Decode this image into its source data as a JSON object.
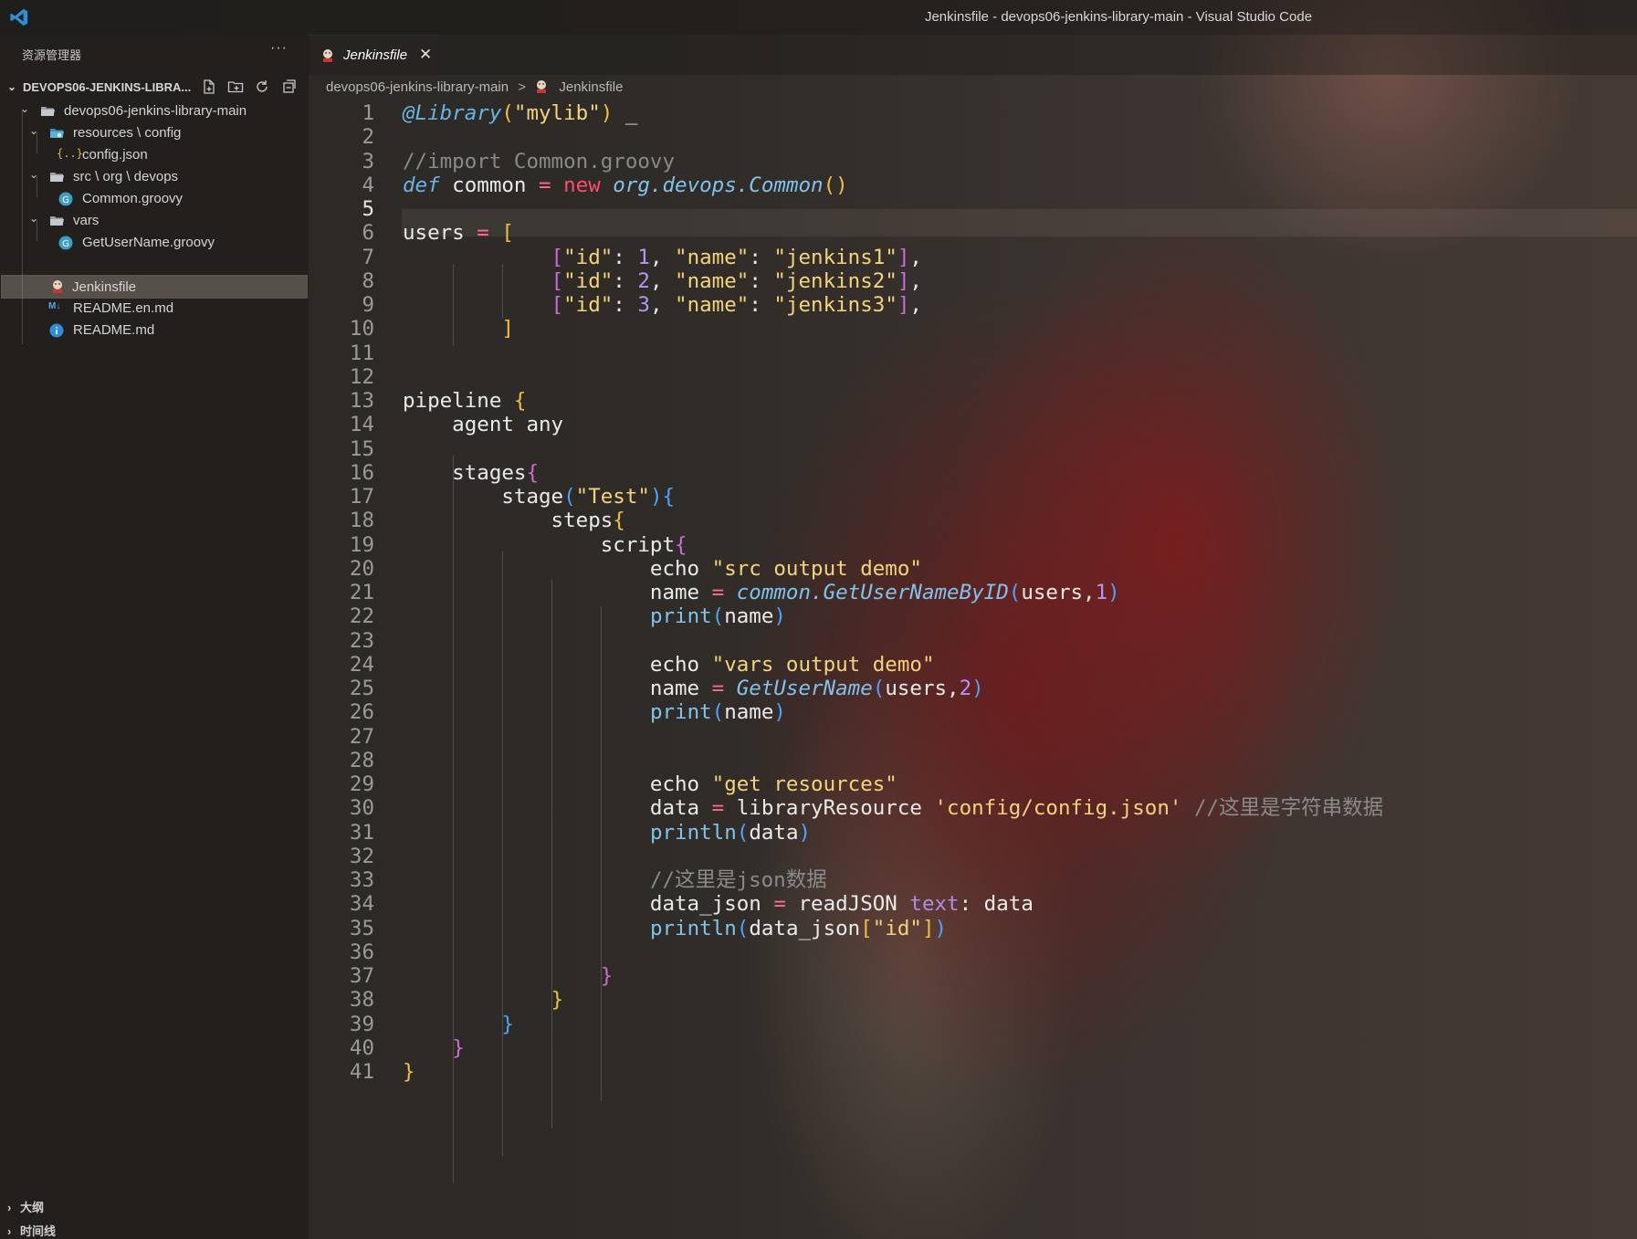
{
  "window": {
    "title": "Jenkinsfile - devops06-jenkins-library-main - Visual Studio Code"
  },
  "sidebar": {
    "header": "资源管理器",
    "more": "···",
    "root_folder": "DEVOPS06-JENKINS-LIBRA...",
    "tree": [
      {
        "label": "devops06-jenkins-library-main",
        "kind": "folder-open"
      },
      {
        "label": "resources \\ config",
        "kind": "folder-open"
      },
      {
        "label": "config.json",
        "kind": "json-file"
      },
      {
        "label": "src \\ org \\ devops",
        "kind": "folder-open"
      },
      {
        "label": "Common.groovy",
        "kind": "groovy-file"
      },
      {
        "label": "vars",
        "kind": "folder-open"
      },
      {
        "label": "GetUserName.groovy",
        "kind": "groovy-file"
      },
      {
        "label": "Jenkinsfile",
        "kind": "jenkins-file",
        "selected": true
      },
      {
        "label": "README.en.md",
        "kind": "markdown-file"
      },
      {
        "label": "README.md",
        "kind": "info-file"
      }
    ],
    "outline_label": "大纲",
    "timeline_label": "时间线"
  },
  "tabs": [
    {
      "label": "Jenkinsfile",
      "close": "✕",
      "active": true
    }
  ],
  "breadcrumb": {
    "folder": "devops06-jenkins-library-main",
    "separator": ">",
    "file": "Jenkinsfile"
  },
  "editor": {
    "active_line": 5,
    "line_numbers": [
      "1",
      "2",
      "3",
      "4",
      "5",
      "6",
      "7",
      "8",
      "9",
      "10",
      "11",
      "12",
      "13",
      "14",
      "15",
      "16",
      "17",
      "18",
      "19",
      "20",
      "21",
      "22",
      "23",
      "24",
      "25",
      "26",
      "27",
      "28",
      "29",
      "30",
      "31",
      "32",
      "33",
      "34",
      "35",
      "36",
      "37",
      "38",
      "39",
      "40",
      "41"
    ],
    "lines": [
      [
        [
          "c-deco",
          "@Library"
        ],
        [
          "c-p1",
          "("
        ],
        [
          "c-str",
          "\"mylib\""
        ],
        [
          "c-p1",
          ")"
        ],
        [
          "c-var",
          " _"
        ]
      ],
      [],
      [
        [
          "c-cm",
          "//import Common.groovy"
        ]
      ],
      [
        [
          "c-kw",
          "def"
        ],
        [
          "c-var",
          " common "
        ],
        [
          "c-op",
          "="
        ],
        [
          "c-new",
          " new"
        ],
        [
          "c-cls",
          " org.devops.Common"
        ],
        [
          "c-p1",
          "()"
        ]
      ],
      [],
      [
        [
          "c-var",
          "users "
        ],
        [
          "c-op",
          "="
        ],
        [
          "c-p1",
          " ["
        ]
      ],
      [
        [
          "c-var",
          "            "
        ],
        [
          "c-p2",
          "["
        ],
        [
          "c-str",
          "\"id\""
        ],
        [
          "c-var",
          ": "
        ],
        [
          "c-num",
          "1"
        ],
        [
          "c-var",
          ", "
        ],
        [
          "c-str",
          "\"name\""
        ],
        [
          "c-var",
          ": "
        ],
        [
          "c-str",
          "\"jenkins1\""
        ],
        [
          "c-p2",
          "]"
        ],
        [
          "c-var",
          ","
        ]
      ],
      [
        [
          "c-var",
          "            "
        ],
        [
          "c-p2",
          "["
        ],
        [
          "c-str",
          "\"id\""
        ],
        [
          "c-var",
          ": "
        ],
        [
          "c-num",
          "2"
        ],
        [
          "c-var",
          ", "
        ],
        [
          "c-str",
          "\"name\""
        ],
        [
          "c-var",
          ": "
        ],
        [
          "c-str",
          "\"jenkins2\""
        ],
        [
          "c-p2",
          "]"
        ],
        [
          "c-var",
          ","
        ]
      ],
      [
        [
          "c-var",
          "            "
        ],
        [
          "c-p2",
          "["
        ],
        [
          "c-str",
          "\"id\""
        ],
        [
          "c-var",
          ": "
        ],
        [
          "c-num",
          "3"
        ],
        [
          "c-var",
          ", "
        ],
        [
          "c-str",
          "\"name\""
        ],
        [
          "c-var",
          ": "
        ],
        [
          "c-str",
          "\"jenkins3\""
        ],
        [
          "c-p2",
          "]"
        ],
        [
          "c-var",
          ","
        ]
      ],
      [
        [
          "c-var",
          "        "
        ],
        [
          "c-p1",
          "]"
        ]
      ],
      [],
      [],
      [
        [
          "c-var",
          "pipeline "
        ],
        [
          "c-p1",
          "{"
        ]
      ],
      [
        [
          "c-var",
          "    agent any"
        ]
      ],
      [],
      [
        [
          "c-var",
          "    stages"
        ],
        [
          "c-p2",
          "{"
        ]
      ],
      [
        [
          "c-var",
          "        stage"
        ],
        [
          "c-par",
          "("
        ],
        [
          "c-str",
          "\"Test\""
        ],
        [
          "c-par",
          ")"
        ],
        [
          "c-p3",
          "{"
        ]
      ],
      [
        [
          "c-var",
          "            steps"
        ],
        [
          "c-p1",
          "{"
        ]
      ],
      [
        [
          "c-var",
          "                script"
        ],
        [
          "c-p2",
          "{"
        ]
      ],
      [
        [
          "c-var",
          "                    echo "
        ],
        [
          "c-str",
          "\"src output demo\""
        ]
      ],
      [
        [
          "c-var",
          "                    name "
        ],
        [
          "c-op",
          "="
        ],
        [
          "c-cls",
          " common.GetUserNameByID"
        ],
        [
          "c-par",
          "("
        ],
        [
          "c-var",
          "users,"
        ],
        [
          "c-num",
          "1"
        ],
        [
          "c-par",
          ")"
        ]
      ],
      [
        [
          "c-var",
          "                    "
        ],
        [
          "c-fn",
          "print"
        ],
        [
          "c-par",
          "("
        ],
        [
          "c-var",
          "name"
        ],
        [
          "c-par",
          ")"
        ]
      ],
      [],
      [
        [
          "c-var",
          "                    echo "
        ],
        [
          "c-str",
          "\"vars output demo\""
        ]
      ],
      [
        [
          "c-var",
          "                    name "
        ],
        [
          "c-op",
          "="
        ],
        [
          "c-cls",
          " GetUserName"
        ],
        [
          "c-par",
          "("
        ],
        [
          "c-var",
          "users,"
        ],
        [
          "c-num",
          "2"
        ],
        [
          "c-par",
          ")"
        ]
      ],
      [
        [
          "c-var",
          "                    "
        ],
        [
          "c-fn",
          "print"
        ],
        [
          "c-par",
          "("
        ],
        [
          "c-var",
          "name"
        ],
        [
          "c-par",
          ")"
        ]
      ],
      [],
      [],
      [
        [
          "c-var",
          "                    echo "
        ],
        [
          "c-str",
          "\"get resources\""
        ]
      ],
      [
        [
          "c-var",
          "                    data "
        ],
        [
          "c-op",
          "="
        ],
        [
          "c-var",
          " libraryResource "
        ],
        [
          "c-str",
          "'config/config.json'"
        ],
        [
          "c-cm",
          " //这里是字符串数据"
        ]
      ],
      [
        [
          "c-var",
          "                    "
        ],
        [
          "c-fn",
          "println"
        ],
        [
          "c-par",
          "("
        ],
        [
          "c-var",
          "data"
        ],
        [
          "c-par",
          ")"
        ]
      ],
      [],
      [
        [
          "c-var",
          "                    "
        ],
        [
          "c-cm",
          "//这里是json数据"
        ]
      ],
      [
        [
          "c-var",
          "                    data_json "
        ],
        [
          "c-op",
          "="
        ],
        [
          "c-var",
          " readJSON "
        ],
        [
          "c-kw2",
          "text"
        ],
        [
          "c-var",
          ": data"
        ]
      ],
      [
        [
          "c-var",
          "                    "
        ],
        [
          "c-fn",
          "println"
        ],
        [
          "c-par",
          "("
        ],
        [
          "c-var",
          "data_json"
        ],
        [
          "c-p1",
          "["
        ],
        [
          "c-str",
          "\"id\""
        ],
        [
          "c-p1",
          "]"
        ],
        [
          "c-par",
          ")"
        ]
      ],
      [],
      [
        [
          "c-var",
          "                "
        ],
        [
          "c-p2",
          "}"
        ]
      ],
      [
        [
          "c-var",
          "            "
        ],
        [
          "c-p1",
          "}"
        ]
      ],
      [
        [
          "c-var",
          "        "
        ],
        [
          "c-p3",
          "}"
        ]
      ],
      [
        [
          "c-var",
          "    "
        ],
        [
          "c-p2",
          "}"
        ]
      ],
      [
        [
          "c-p1",
          "}"
        ]
      ]
    ]
  }
}
